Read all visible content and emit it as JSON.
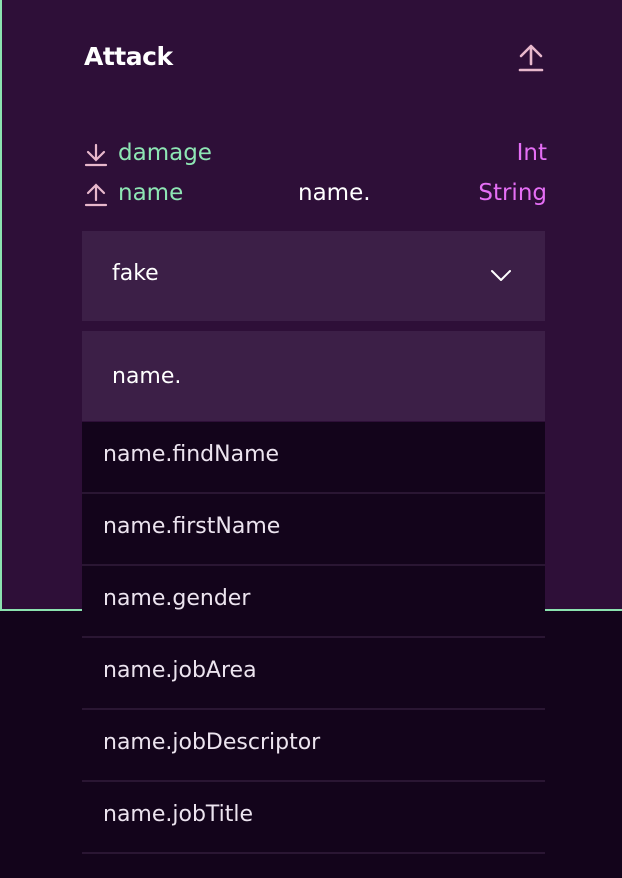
{
  "component": {
    "title": "Attack",
    "ports": [
      {
        "direction": "input",
        "icon": "download-icon",
        "name": "damage",
        "value": "",
        "type": "Int"
      },
      {
        "direction": "output",
        "icon": "upload-icon",
        "name": "name",
        "value": "name.",
        "type": "String"
      }
    ],
    "select": {
      "value": "fake"
    },
    "search": {
      "value": "name."
    },
    "options": [
      "name.findName",
      "name.firstName",
      "name.gender",
      "name.jobArea",
      "name.jobDescriptor",
      "name.jobTitle"
    ]
  },
  "colors": {
    "panel_bg": "#2e0f38",
    "page_bg": "#13041b",
    "accent_green": "#8ee6b4",
    "type_magenta": "#e56ef5",
    "icon_pink": "#e8b8cc"
  }
}
